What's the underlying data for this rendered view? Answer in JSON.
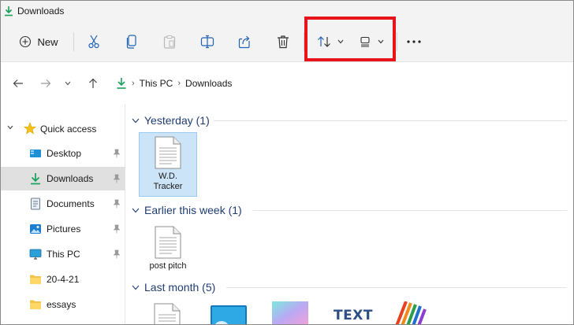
{
  "window": {
    "title": "Downloads"
  },
  "toolbar": {
    "new_label": "New",
    "buttons": [
      "cut-icon",
      "copy-icon",
      "paste-icon",
      "rename-icon",
      "share-icon",
      "delete-icon",
      "sort-icon",
      "view-icon",
      "more-icon"
    ]
  },
  "address": {
    "crumbs": [
      "This PC",
      "Downloads"
    ]
  },
  "sidebar": {
    "quick_access": "Quick access",
    "items": [
      {
        "label": "Desktop",
        "icon": "desktop-icon",
        "pinned": true
      },
      {
        "label": "Downloads",
        "icon": "download-icon",
        "pinned": true,
        "selected": true
      },
      {
        "label": "Documents",
        "icon": "documents-icon",
        "pinned": true
      },
      {
        "label": "Pictures",
        "icon": "pictures-icon",
        "pinned": true
      },
      {
        "label": "This PC",
        "icon": "this-pc-icon",
        "pinned": true
      },
      {
        "label": "20-4-21",
        "icon": "folder-icon",
        "pinned": false
      },
      {
        "label": "essays",
        "icon": "folder-icon",
        "pinned": false
      }
    ]
  },
  "groups": [
    {
      "header": "Yesterday (1)",
      "files": [
        {
          "name": "W.D. Tracker",
          "selected": true
        }
      ]
    },
    {
      "header": "Earlier this week (1)",
      "files": [
        {
          "name": "post pitch",
          "selected": false
        }
      ]
    },
    {
      "header": "Last month (5)",
      "files": []
    }
  ],
  "thumbs": {
    "text_label": "TEXT"
  },
  "colors": {
    "accent": "#1f3d73",
    "highlight": "#e8131b",
    "selection": "#cce4f7"
  }
}
